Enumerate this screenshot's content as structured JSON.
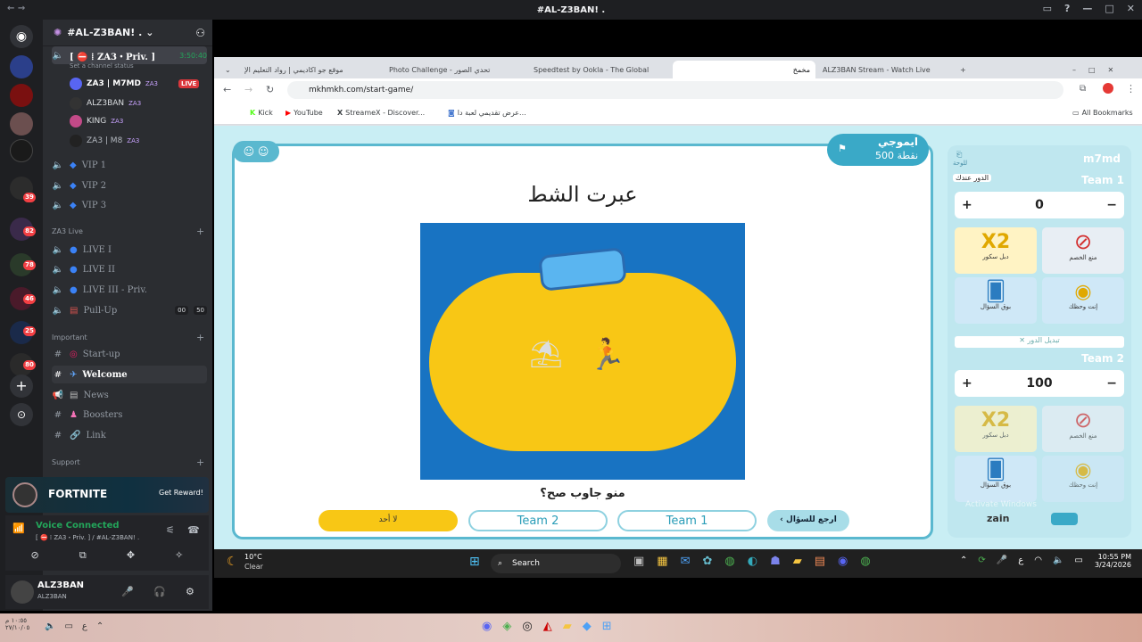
{
  "window": {
    "title": "#AL-Z3BAN! ."
  },
  "discord": {
    "guild_name": "#AL-Z3BAN! .",
    "server_badges": [
      "39",
      "82",
      "78",
      "46",
      "25",
      "80"
    ],
    "active_channel": {
      "name": "[ ⛔ ⁞ ZA3・Priv. ]",
      "timer": "3:50:40",
      "status": "Set a channel status"
    },
    "voice_users": [
      {
        "name": "ZA3 | M7MD",
        "tag": "ZA3",
        "live": "LIVE"
      },
      {
        "name": "ALZ3BAN",
        "tag": "ZA3"
      },
      {
        "name": "KING",
        "tag": "ZA3"
      },
      {
        "name": "ZA3 | M8",
        "tag": "ZA3"
      }
    ],
    "vip_channels": [
      "VIP 1",
      "VIP 2",
      "VIP 3"
    ],
    "cat_live": "ZA3 Live",
    "live_channels": [
      "LIVE I",
      "LIVE II",
      "LIVE III - Priv."
    ],
    "pullup": {
      "name": "Pull-Up",
      "count_a": "00",
      "count_b": "50"
    },
    "cat_important": "Important",
    "text_channels": [
      "Start-up",
      "Welcome",
      "News",
      "Boosters",
      "Link"
    ],
    "cat_support": "Support",
    "promo": {
      "game": "FORTNITE",
      "button": "Get Reward!"
    },
    "voice_status": {
      "title": "Voice Connected",
      "detail": "[ ⛔ ⁞ ZA3・Priv. ] / #AL-Z3BAN! ."
    },
    "user": {
      "name": "ALZ3BAN",
      "status": "ALZ3BAN"
    }
  },
  "browser": {
    "tabs": [
      "موقع جو اكاديمي | رواد التعليم الإ",
      "Photo Challenge - تحدي الصور",
      "Speedtest by Ookla - The Global",
      "مخمخ",
      "ALZ3BAN Stream - Watch Live"
    ],
    "url": "mkhmkh.com/start-game/",
    "bookmarks": [
      "Kick",
      "YouTube",
      "StreameX - Discover...",
      "عرض تقديمي لعبة دا..."
    ],
    "all_bookmarks": "All Bookmarks"
  },
  "game": {
    "emoji_label": "ايموجي",
    "points": "500 نقطة",
    "title": "عبرت الشط",
    "question": "منو جاوب صح؟",
    "buttons": {
      "none": "لا أحد",
      "team2": "Team 2",
      "team1": "Team 1",
      "back": "ارجع للسؤال"
    },
    "panel": {
      "player": "m7md",
      "board": "للوحة",
      "team1": {
        "name": "Team 1",
        "turn": "الدور عندك",
        "score": "0"
      },
      "team2": {
        "name": "Team 2",
        "score": "100"
      },
      "switch_turn": "تبديل الدور",
      "powerups": [
        "دبل سكور",
        "منع الخصم",
        "بوق السؤال",
        "إنت وحظك"
      ],
      "sponsor": "zain"
    },
    "watermark": "Activate Windows"
  },
  "taskbar": {
    "weather_temp": "10°C",
    "weather_desc": "Clear",
    "search": "Search",
    "time": "10:55 PM",
    "date": "3/24/2026",
    "lang": "ع"
  },
  "bottom": {
    "time": "١٠:٥٥ م",
    "date": "٢٧/١٠/٠٥"
  }
}
